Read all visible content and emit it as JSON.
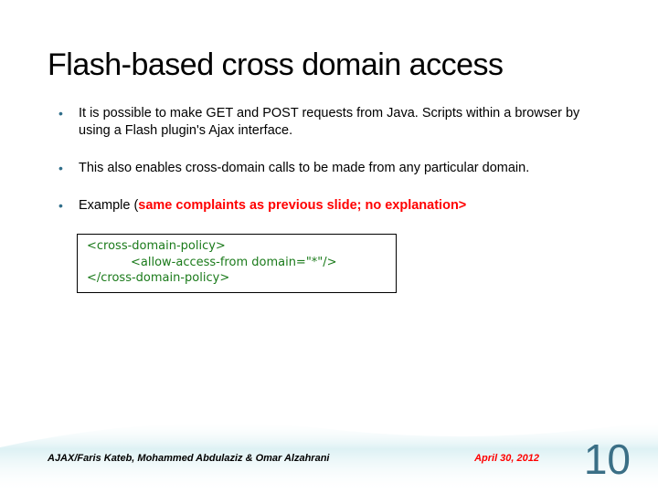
{
  "title": "Flash-based cross domain access",
  "bullets": [
    "It is possible to make GET and POST requests from Java. Scripts within a browser by using a Flash plugin's Ajax interface.",
    "This also enables cross-domain calls to be made from any particular domain."
  ],
  "bullet3_prefix": "Example (",
  "bullet3_red": "same complaints as previous slide; no explanation>",
  "code": {
    "line1": "<cross-domain-policy>",
    "line2": "<allow-access-from domain=\"*\"/>",
    "line3": "</cross-domain-policy>"
  },
  "footer": {
    "left": "AJAX/Faris Kateb, Mohammed Abdulaziz & Omar Alzahrani",
    "date": "April 30, 2012"
  },
  "page_number": "10"
}
